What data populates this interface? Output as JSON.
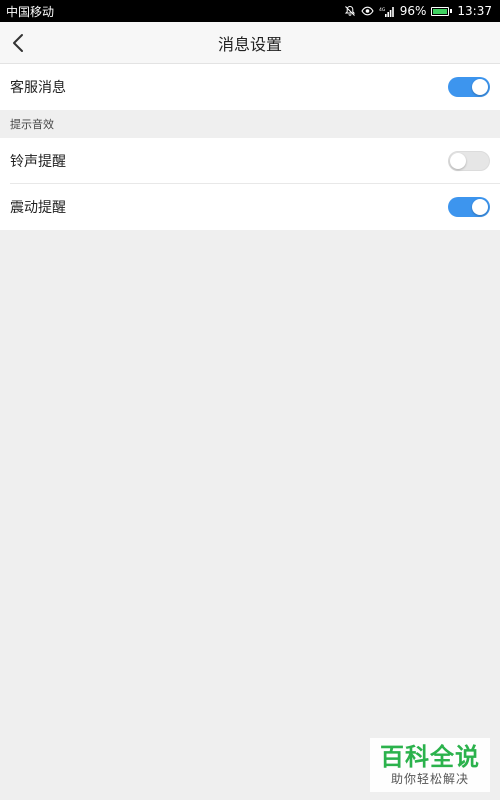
{
  "status_bar": {
    "carrier": "中国移动",
    "battery_percent": "96%",
    "time": "13:37",
    "icons": [
      "mute-icon",
      "eye-icon",
      "signal-icon",
      "battery-icon"
    ]
  },
  "header": {
    "title": "消息设置",
    "back_icon": "chevron-left-icon"
  },
  "settings": {
    "customer_service": {
      "label": "客服消息",
      "enabled": true
    },
    "section_title": "提示音效",
    "ringtone": {
      "label": "铃声提醒",
      "enabled": false
    },
    "vibration": {
      "label": "震动提醒",
      "enabled": true
    }
  },
  "watermark": {
    "main": "百科全说",
    "sub": "助你轻松解决"
  },
  "colors": {
    "toggle_on": "#3d95ee",
    "toggle_off": "#e6e6e6",
    "background": "#efefef",
    "watermark_green": "#2bb24c"
  }
}
